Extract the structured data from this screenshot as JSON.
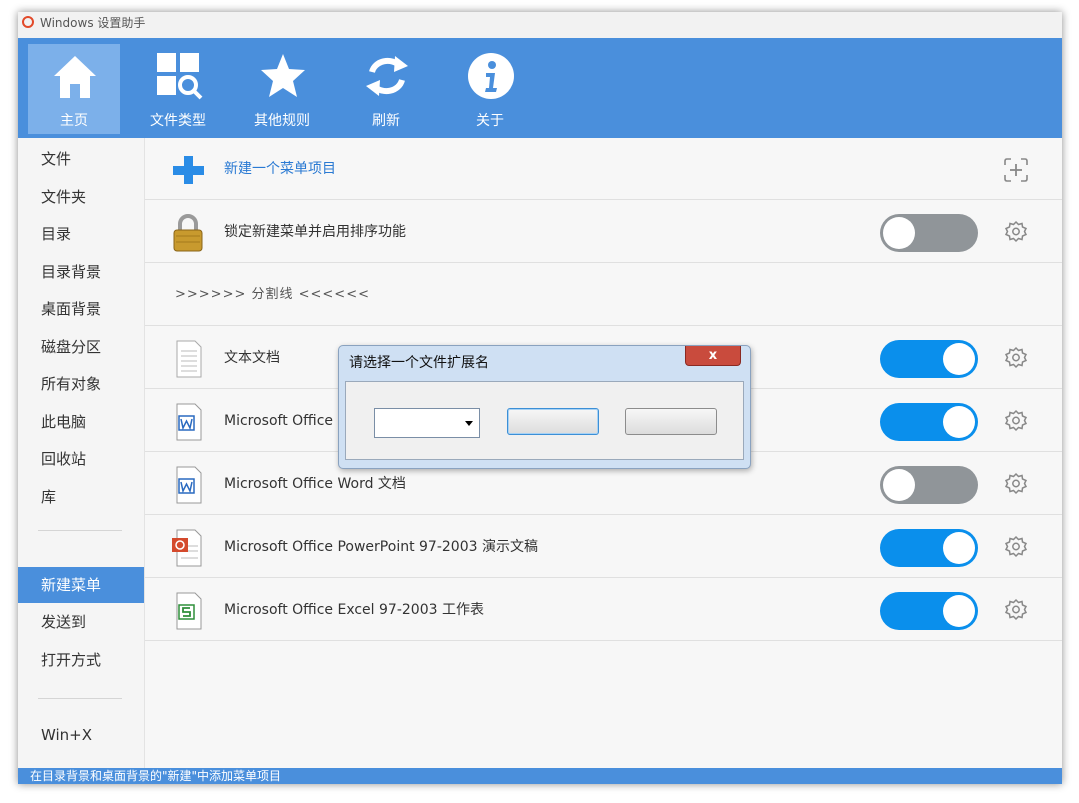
{
  "window": {
    "title": "Windows 设置助手"
  },
  "toolbar": {
    "items": [
      {
        "label": "主页",
        "icon": "home-icon",
        "active": true
      },
      {
        "label": "文件类型",
        "icon": "file-type-search-icon",
        "active": false
      },
      {
        "label": "其他规则",
        "icon": "star-icon",
        "active": false
      },
      {
        "label": "刷新",
        "icon": "refresh-icon",
        "active": false
      },
      {
        "label": "关于",
        "icon": "info-icon",
        "active": false
      }
    ]
  },
  "sidebar": {
    "items": [
      "文件",
      "文件夹",
      "目录",
      "目录背景",
      "桌面背景",
      "磁盘分区",
      "所有对象",
      "此电脑",
      "回收站",
      "库"
    ],
    "menu_items": [
      "新建菜单",
      "发送到",
      "打开方式"
    ],
    "bottom_item": "Win+X"
  },
  "main": {
    "new_item_label": "新建一个菜单项目",
    "lock_label": "锁定新建菜单并启用排序功能",
    "lock_toggle": "off",
    "separator_label": ">>>>>> 分割线 <<<<<<",
    "entries": [
      {
        "label": "文本文档",
        "icon": "text-document-icon",
        "toggle": "on"
      },
      {
        "label": "Microsoft Office",
        "icon": "word-document-icon",
        "toggle": "on"
      },
      {
        "label": "Microsoft Office Word 文档",
        "icon": "word-document-icon",
        "toggle": "off"
      },
      {
        "label": "Microsoft Office PowerPoint 97-2003 演示文稿",
        "icon": "powerpoint-document-icon",
        "toggle": "on"
      },
      {
        "label": "Microsoft Office Excel 97-2003 工作表",
        "icon": "excel-document-icon",
        "toggle": "on"
      }
    ]
  },
  "dialog": {
    "title": "请选择一个文件扩展名",
    "close_label": "x",
    "select_value": "",
    "ok_label": "",
    "cancel_label": ""
  },
  "statusbar": {
    "text": "在目录背景和桌面背景的\"新建\"中添加菜单项目"
  },
  "colors": {
    "accent": "#4a8fdc",
    "toggle_on": "#0a8fec",
    "toggle_off": "#909599"
  }
}
